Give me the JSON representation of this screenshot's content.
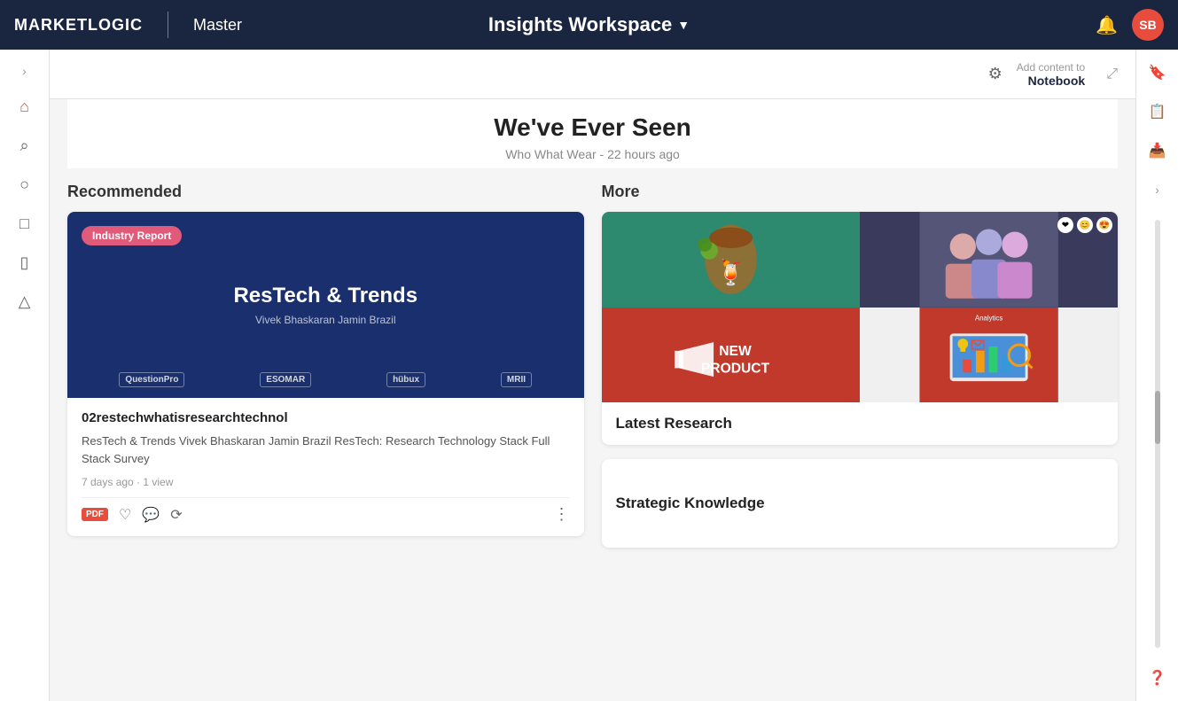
{
  "app": {
    "logo_text": "MARKETLOGIC",
    "nav_label": "Master",
    "workspace_title": "Insights Workspace",
    "avatar_initials": "SB"
  },
  "toolbar": {
    "add_line1": "Add content to",
    "add_line2": "Notebook"
  },
  "article": {
    "title": "We've Ever Seen",
    "meta": "Who What Wear - 22 hours ago"
  },
  "sections": {
    "recommended_label": "Recommended",
    "more_label": "More"
  },
  "recommended_card": {
    "badge": "Industry Report",
    "title": "ResTech & Trends",
    "authors": "Vivek Bhaskaran        Jamin Brazil",
    "logo1": "QuestionPro",
    "logo2": "ESOMAR",
    "logo3": "hübux",
    "logo4": "MRII",
    "doc_title": "02restechwhatisresearchtechnol",
    "description": "ResTech & Trends Vivek Bhaskaran Jamin Brazil ResTech: Research Technology Stack Full Stack Survey",
    "meta": "7 days ago · 1 view"
  },
  "latest_research": {
    "title": "Latest Research"
  },
  "strategic_knowledge": {
    "title": "Strategic Knowledge"
  },
  "sidebar": {
    "items": [
      {
        "name": "home",
        "icon": "🏠",
        "active": true
      },
      {
        "name": "search",
        "icon": "🔍",
        "active": false
      },
      {
        "name": "globe",
        "icon": "🌐",
        "active": false
      },
      {
        "name": "layers",
        "icon": "🎓",
        "active": false
      },
      {
        "name": "document",
        "icon": "📋",
        "active": false
      },
      {
        "name": "upload",
        "icon": "⬆",
        "active": false
      }
    ]
  },
  "right_sidebar": {
    "items": [
      {
        "name": "bookmark",
        "icon": "🔖"
      },
      {
        "name": "checklist",
        "icon": "📋"
      },
      {
        "name": "inbox",
        "icon": "📥"
      },
      {
        "name": "help",
        "icon": "❓"
      }
    ]
  }
}
